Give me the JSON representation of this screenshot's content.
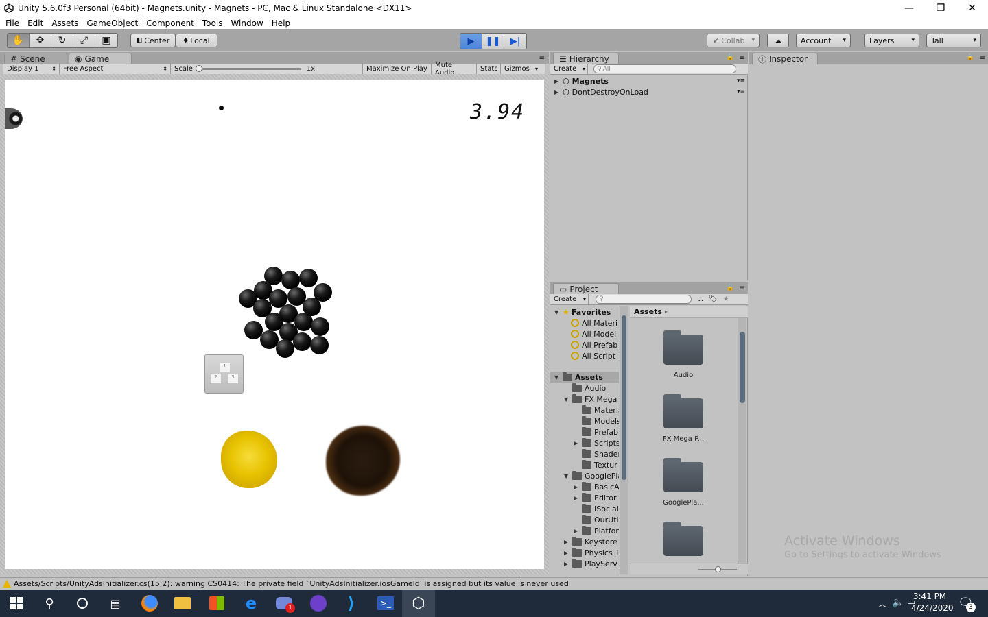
{
  "window": {
    "title": "Unity 5.6.0f3 Personal (64bit) - Magnets.unity - Magnets - PC, Mac & Linux Standalone <DX11>",
    "minimize": "—",
    "maximize": "❐",
    "close": "✕"
  },
  "menu": [
    "File",
    "Edit",
    "Assets",
    "GameObject",
    "Component",
    "Tools",
    "Window",
    "Help"
  ],
  "toolbar": {
    "center_label": "Center",
    "local_label": "Local",
    "collab_label": "Collab",
    "account_label": "Account",
    "layers_label": "Layers",
    "layout_label": "Tall"
  },
  "scene_tab": "Scene",
  "game_tab": "Game",
  "game_bar": {
    "display": "Display 1",
    "aspect": "Free Aspect",
    "scale_label": "Scale",
    "scale_value": "1x",
    "maximize": "Maximize On Play",
    "mute": "Mute Audio",
    "stats": "Stats",
    "gizmos": "Gizmos"
  },
  "game": {
    "timer": "3.94",
    "crate_labels": [
      "1",
      "2",
      "3"
    ]
  },
  "hierarchy": {
    "tab": "Hierarchy",
    "create": "Create",
    "search_placeholder": "All",
    "items": [
      "Magnets",
      "DontDestroyOnLoad"
    ]
  },
  "inspector": {
    "tab": "Inspector"
  },
  "project": {
    "tab": "Project",
    "create": "Create",
    "favorites_label": "Favorites",
    "favorites": [
      "All Materi",
      "All Model",
      "All Prefab",
      "All Script"
    ],
    "assets_root": "Assets",
    "tree": [
      {
        "label": "Audio",
        "indent": 1,
        "arrow": ""
      },
      {
        "label": "FX Mega",
        "indent": 1,
        "arrow": "▼"
      },
      {
        "label": "Materia",
        "indent": 2,
        "arrow": ""
      },
      {
        "label": "Models",
        "indent": 2,
        "arrow": ""
      },
      {
        "label": "Prefab",
        "indent": 2,
        "arrow": ""
      },
      {
        "label": "Scripts",
        "indent": 2,
        "arrow": "▶"
      },
      {
        "label": "Shader",
        "indent": 2,
        "arrow": ""
      },
      {
        "label": "Textur",
        "indent": 2,
        "arrow": ""
      },
      {
        "label": "GooglePla",
        "indent": 1,
        "arrow": "▼"
      },
      {
        "label": "BasicA",
        "indent": 2,
        "arrow": "▶"
      },
      {
        "label": "Editor",
        "indent": 2,
        "arrow": "▶"
      },
      {
        "label": "ISocial",
        "indent": 2,
        "arrow": ""
      },
      {
        "label": "OurUtil",
        "indent": 2,
        "arrow": ""
      },
      {
        "label": "Platfor",
        "indent": 2,
        "arrow": "▶"
      },
      {
        "label": "Keystore",
        "indent": 1,
        "arrow": "▶"
      },
      {
        "label": "Physics_I",
        "indent": 1,
        "arrow": "▶"
      },
      {
        "label": "PlayServ",
        "indent": 1,
        "arrow": "▶"
      }
    ],
    "breadcrumb": "Assets",
    "grid": [
      "Audio",
      "FX Mega P...",
      "GooglePla...",
      ""
    ]
  },
  "status": {
    "message": "Assets/Scripts/UnityAdsInitializer.cs(15,2): warning CS0414: The private field `UnityAdsInitializer.iosGameId' is assigned but its value is never used"
  },
  "watermark": {
    "line1": "Activate Windows",
    "line2": "Go to Settings to activate Windows"
  },
  "taskbar": {
    "time": "3:41 PM",
    "date": "4/24/2020",
    "discord_badge": "1",
    "notif_count": "3"
  },
  "colors": {
    "accent_play": "#4d84d6",
    "taskbar": "#1f2a3a",
    "warning": "#e8b400"
  }
}
